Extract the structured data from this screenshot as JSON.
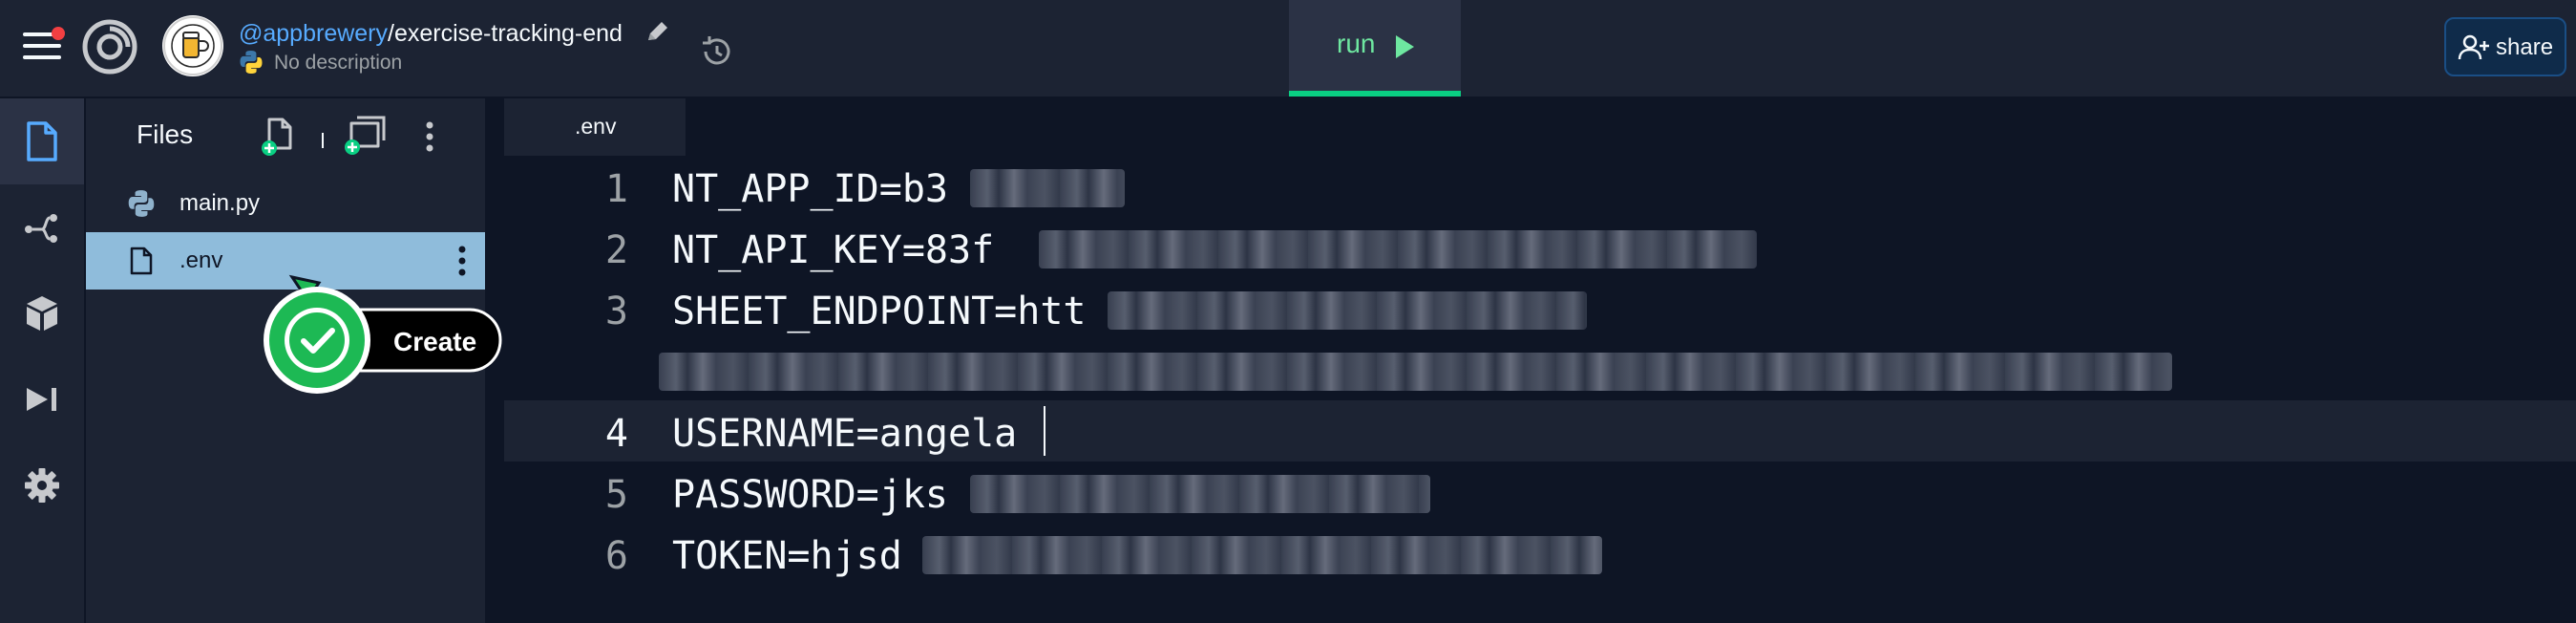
{
  "header": {
    "owner": "@appbrewery",
    "slash": "/",
    "repl_name": "exercise-tracking-end",
    "description": "No description",
    "run_label": "run",
    "share_label": "share"
  },
  "files_panel": {
    "title": "Files",
    "files": [
      {
        "name": "main.py",
        "icon": "python-icon"
      },
      {
        "name": ".env",
        "icon": "file-icon",
        "selected": true
      }
    ]
  },
  "editor": {
    "tab_label": ".env",
    "lines": [
      {
        "number": "1",
        "text": "NT_APP_ID=b3"
      },
      {
        "number": "2",
        "text": "NT_API_KEY=83f"
      },
      {
        "number": "3",
        "text": "SHEET_ENDPOINT=htt"
      },
      {
        "number": "4",
        "text": "USERNAME=angela",
        "active": true
      },
      {
        "number": "5",
        "text": "PASSWORD=jks"
      },
      {
        "number": "6",
        "text": "TOKEN=hjsd"
      }
    ]
  },
  "overlay": {
    "create_label": "Create"
  },
  "colors": {
    "background": "#0e1525",
    "panel": "#1c2333",
    "accent_blue": "#57abff",
    "run_green": "#0acf83",
    "selected_row": "#8fbcdb",
    "create_green": "#1db954"
  },
  "icons": {
    "menu": "hamburger-icon",
    "logo": "replit-logo-icon",
    "edit": "pencil-icon",
    "history": "history-icon",
    "share": "add-user-icon",
    "rail": [
      "files-icon",
      "version-control-icon",
      "packages-icon",
      "debugger-icon",
      "settings-icon"
    ]
  }
}
